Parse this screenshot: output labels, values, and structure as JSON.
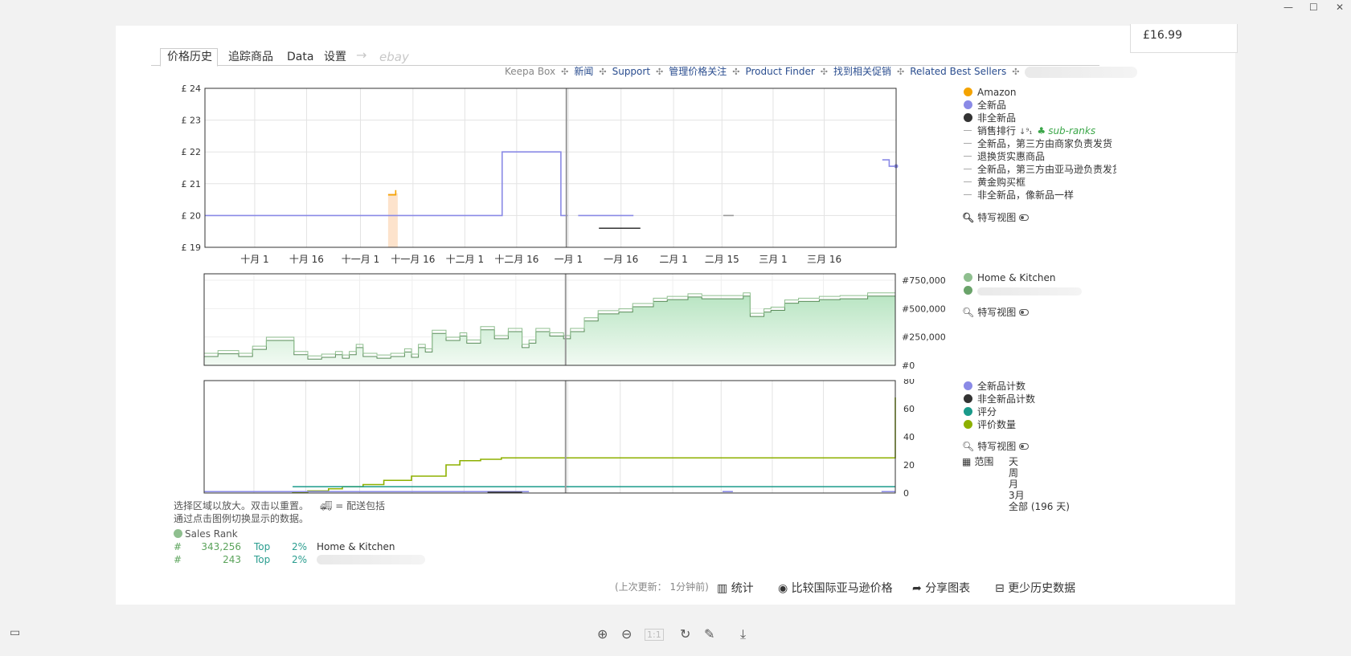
{
  "window": {
    "minimize": "—",
    "maximize": "☐",
    "close": "✕"
  },
  "price_box": "£16.99",
  "tabs": [
    "价格历史",
    "追踪商品",
    "Data",
    "设置",
    "→",
    "ebay"
  ],
  "toplinks": {
    "keepa_box": "Keepa Box",
    "news": "新闻",
    "support": "Support",
    "manage": "管理价格关注",
    "finder": "Product Finder",
    "deals": "找到相关促销",
    "sellers": "Related Best Sellers"
  },
  "chart_data": [
    {
      "type": "line",
      "name": "price",
      "ylim": [
        19,
        24
      ],
      "yticks": [
        "£ 24",
        "£ 23",
        "£ 22",
        "£ 21",
        "£ 20",
        "£ 19"
      ],
      "xticks": [
        "十月 1",
        "十月 16",
        "十一月 1",
        "十一月 16",
        "十二月 1",
        "十二月 16",
        "一月 1",
        "一月 16",
        "二月 1",
        "二月 15",
        "三月 1",
        "三月 16"
      ],
      "series": [
        {
          "name": "Amazon",
          "color": "#f4a300",
          "points": [
            [
              0.265,
              20.65
            ],
            [
              0.276,
              20.65
            ],
            [
              0.276,
              20.8
            ]
          ]
        },
        {
          "name": "全新品",
          "color": "#8a8ae6",
          "points": [
            [
              0.0,
              20.0
            ],
            [
              0.283,
              20.0
            ],
            [
              0.283,
              20.0
            ],
            [
              0.43,
              20.0
            ],
            [
              0.43,
              22.0
            ],
            [
              0.515,
              22.0
            ],
            [
              0.515,
              20.0
            ],
            [
              0.525,
              20.0
            ]
          ]
        },
        {
          "name": "全新品b",
          "color": "#8a8ae6",
          "points": [
            [
              0.54,
              20.0
            ],
            [
              0.62,
              20.0
            ]
          ]
        },
        {
          "name": "非全新品",
          "color": "#333333",
          "points": [
            [
              0.57,
              19.6
            ],
            [
              0.63,
              19.6
            ]
          ]
        },
        {
          "name": "非全新品b",
          "color": "#999999",
          "points": [
            [
              0.75,
              20.0
            ],
            [
              0.765,
              20.0
            ]
          ]
        },
        {
          "name": "全新品c",
          "color": "#8a8ae6",
          "points": [
            [
              0.98,
              21.75
            ],
            [
              0.99,
              21.75
            ],
            [
              0.99,
              21.55
            ],
            [
              1.0,
              21.55
            ]
          ]
        }
      ]
    },
    {
      "type": "area",
      "name": "sales-rank",
      "ylim": [
        0,
        750000
      ],
      "yticks": [
        "#750,000",
        "#500,000",
        "#250,000",
        "#0"
      ]
    },
    {
      "type": "line",
      "name": "counts",
      "ylim": [
        0,
        80
      ],
      "yticks": [
        "80",
        "60",
        "40",
        "20",
        "0"
      ]
    }
  ],
  "legend1": {
    "amazon": "Amazon",
    "new": "全新品",
    "used": "非全新品",
    "sales_rank": "销售排行",
    "subranks": "sub-ranks",
    "fba": "全新品，第三方由商家负责发货",
    "warehouse": "退换货实惠商品",
    "fba2": "全新品，第三方由亚马逊负责发货",
    "buybox": "黄金购买框",
    "like_new": "非全新品，像新品一样",
    "closeup": "特写视图"
  },
  "legend2": {
    "home": "Home & Kitchen",
    "closeup": "特写视图"
  },
  "legend3": {
    "new_count": "全新品计数",
    "used_count": "非全新品计数",
    "rating": "评分",
    "review_count": "评价数量",
    "closeup": "特写视图",
    "range": "范围",
    "ranges": [
      "天",
      "周",
      "月",
      "3月",
      "全部 (196 天)"
    ]
  },
  "info": {
    "line1": "选择区域以放大。双击以重置。",
    "shipping": "= 配送包括",
    "line2": "通过点击图例切换显示的数据。"
  },
  "rank": {
    "title": "Sales Rank",
    "rows": [
      {
        "hash": "#",
        "num": "343,256",
        "top": "Top",
        "pct": "2%",
        "cat": "Home & Kitchen"
      },
      {
        "hash": "#",
        "num": "243",
        "top": "Top",
        "pct": "2%",
        "cat": ""
      }
    ]
  },
  "footer": {
    "updated": "(上次更新： 1分钟前)",
    "stats": "统计",
    "compare": "比较国际亚马逊价格",
    "share": "分享图表",
    "less": "更少历史数据"
  }
}
